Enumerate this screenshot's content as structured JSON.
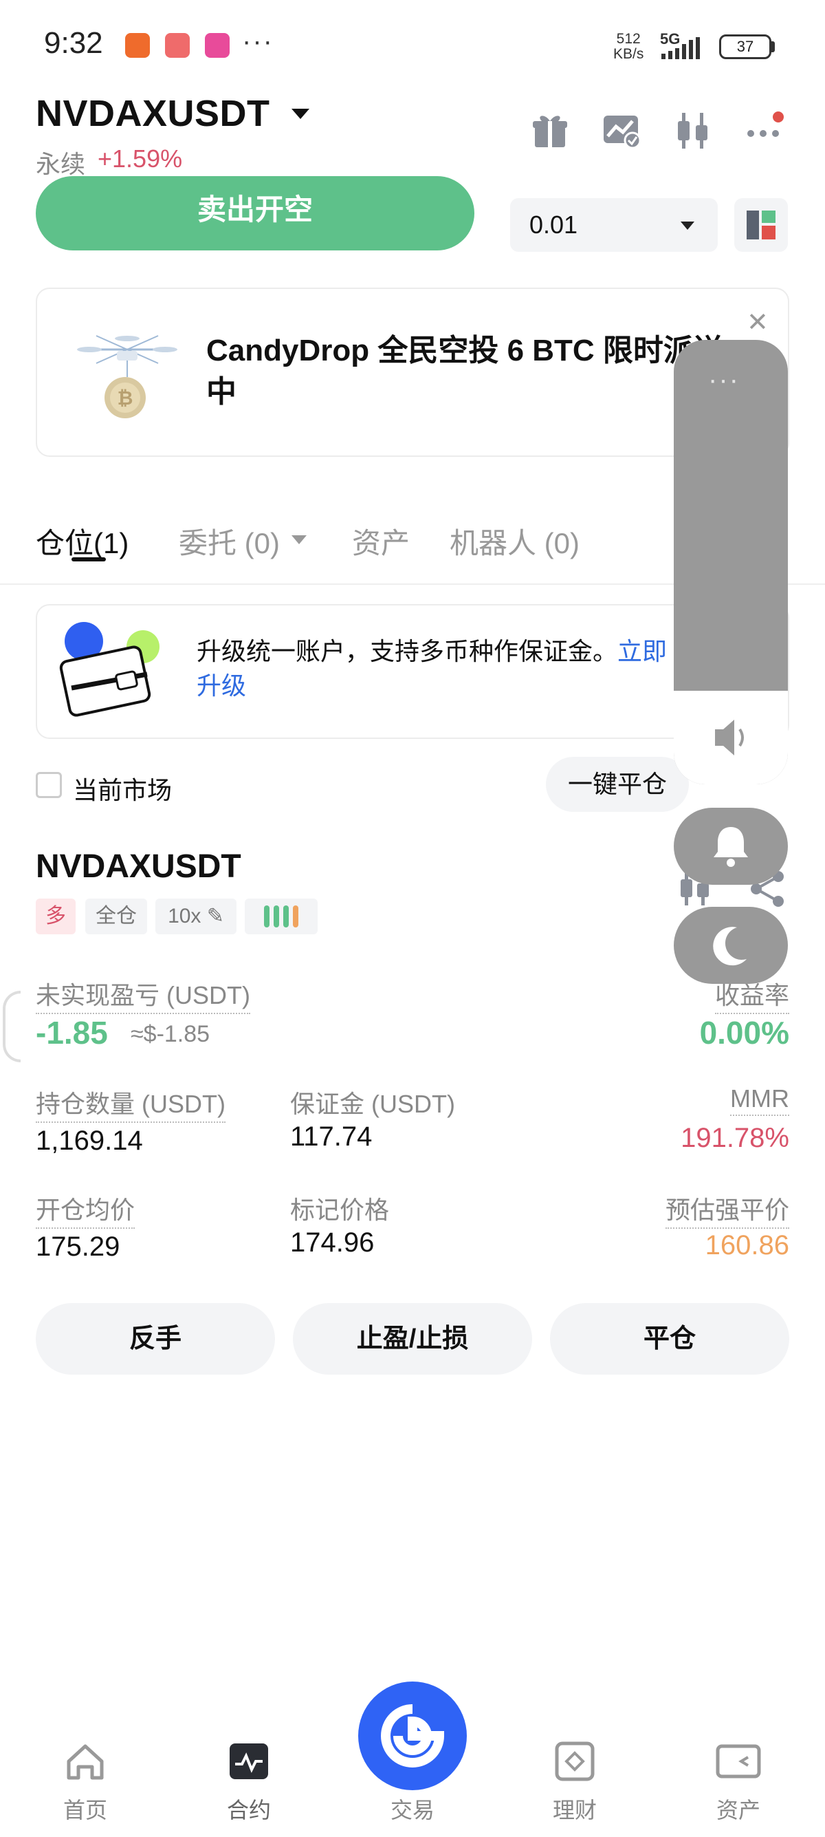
{
  "status_bar": {
    "time": "9:32",
    "more": "···",
    "net_speed_value": "512",
    "net_speed_unit": "KB/s",
    "network": "5G",
    "battery": "37"
  },
  "header": {
    "symbol": "NVDAXUSDT",
    "type": "永续",
    "change": "+1.59%",
    "icons": [
      "gift-icon",
      "chart-check-icon",
      "candlestick-icon",
      "more-icon"
    ]
  },
  "order": {
    "sell_button": "卖出开空",
    "quantity": "0.01"
  },
  "banner": {
    "text": "CandyDrop 全民空投 6 BTC 限时派送中"
  },
  "tabs": [
    {
      "label": "仓位",
      "count": "(1)"
    },
    {
      "label": "委托 (0)"
    },
    {
      "label": "资产"
    },
    {
      "label": "机器人 (0)"
    }
  ],
  "upgrade": {
    "text": "升级统一账户，支持多币种作保证金。",
    "link": "立即升级"
  },
  "filter": {
    "current_market": "当前市场",
    "close_all": "一键平仓"
  },
  "position": {
    "symbol": "NVDAXUSDT",
    "side": "多",
    "margin_mode": "全仓",
    "leverage": "10x",
    "risk_level_bars": [
      "#5ec18a",
      "#5ec18a",
      "#5ec18a",
      "#f0a35e"
    ],
    "unrealized_pnl_label": "未实现盈亏 (USDT)",
    "unrealized_pnl": "-1.85",
    "unrealized_pnl_usd": "≈$-1.85",
    "roe_label": "收益率",
    "roe": "0.00%",
    "size_label": "持仓数量 (USDT)",
    "size": "1,169.14",
    "margin_label": "保证金 (USDT)",
    "margin": "117.74",
    "mmr_label": "MMR",
    "mmr": "191.78%",
    "entry_label": "开仓均价",
    "entry": "175.29",
    "mark_label": "标记价格",
    "mark": "174.96",
    "liq_label": "预估强平价",
    "liq": "160.86"
  },
  "position_actions": {
    "reverse": "反手",
    "tpsl": "止盈/止损",
    "close": "平仓"
  },
  "float_panel": {
    "menu": "···"
  },
  "bottom_nav": [
    {
      "label": "首页",
      "icon": "home-icon"
    },
    {
      "label": "合约",
      "icon": "futures-icon"
    },
    {
      "label": "交易",
      "icon": "trade-icon"
    },
    {
      "label": "理财",
      "icon": "earn-icon"
    },
    {
      "label": "资产",
      "icon": "wallet-icon"
    }
  ],
  "colors": {
    "green": "#5ec18a",
    "red": "#d8536a",
    "orange": "#f0a35e",
    "blue": "#2f63f5",
    "link": "#2f6be0"
  }
}
